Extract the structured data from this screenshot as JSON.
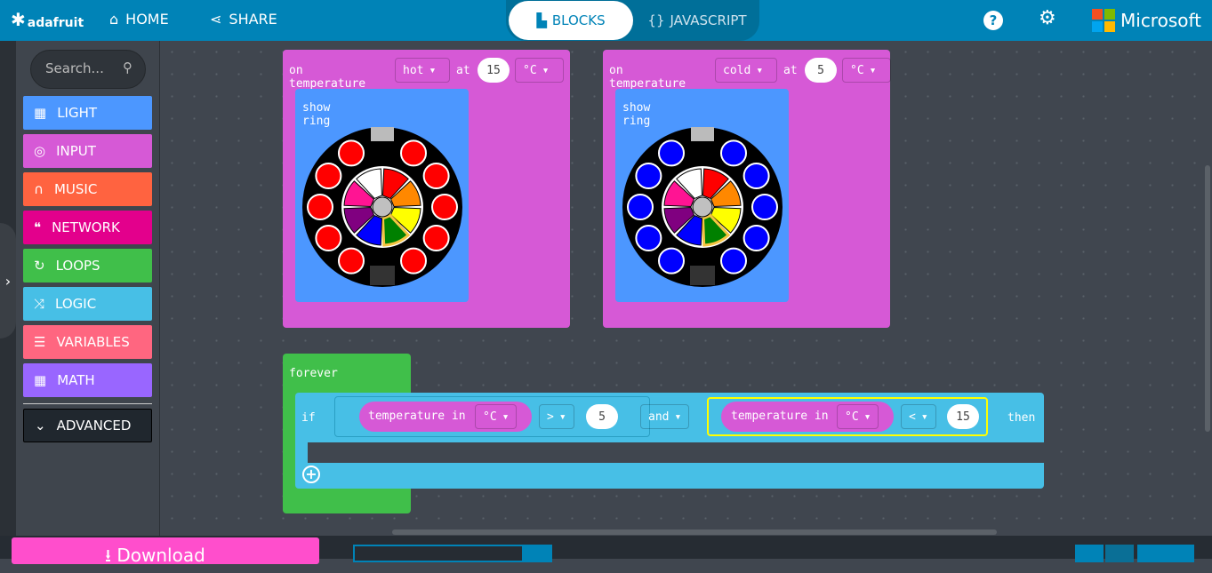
{
  "header": {
    "brand": "adafruit",
    "home": "HOME",
    "share": "SHARE",
    "tabs": {
      "blocks": "BLOCKS",
      "javascript": "JAVASCRIPT",
      "active": "blocks"
    },
    "microsoft": "Microsoft"
  },
  "toolbox": {
    "search_placeholder": "Search...",
    "categories": [
      {
        "label": "LIGHT",
        "color": "#4c97ff",
        "icon": "grid-icon"
      },
      {
        "label": "INPUT",
        "color": "#d659d6",
        "icon": "target-icon"
      },
      {
        "label": "MUSIC",
        "color": "#ff6340",
        "icon": "headphones-icon"
      },
      {
        "label": "NETWORK",
        "color": "#e3008c",
        "icon": "chat-icon"
      },
      {
        "label": "LOOPS",
        "color": "#40bf4a",
        "icon": "loop-icon"
      },
      {
        "label": "LOGIC",
        "color": "#47bfe6",
        "icon": "shuffle-icon"
      },
      {
        "label": "VARIABLES",
        "color": "#ff6680",
        "icon": "lines-icon"
      },
      {
        "label": "MATH",
        "color": "#9966ff",
        "icon": "calculator-icon"
      }
    ],
    "advanced": "ADVANCED"
  },
  "blocks": {
    "hot": {
      "prefix": "on temperature",
      "condition": "hot",
      "at": "at",
      "value": "15",
      "unit": "°C",
      "show_ring": "show ring",
      "led_color": "#ff0000"
    },
    "cold": {
      "prefix": "on temperature",
      "condition": "cold",
      "at": "at",
      "value": "5",
      "unit": "°C",
      "show_ring": "show ring",
      "led_color": "#0000ff"
    },
    "forever": {
      "label": "forever",
      "if": "if",
      "then": "then",
      "left": {
        "reporter": "temperature in",
        "unit": "°C",
        "op": ">",
        "value": "5"
      },
      "joiner": "and",
      "right": {
        "reporter": "temperature in",
        "unit": "°C",
        "op": "<",
        "value": "15"
      }
    }
  },
  "wheel_colors": [
    "#ffffff",
    "#ff0000",
    "#ff8800",
    "#ffff00",
    "#008000",
    "#0000ff",
    "#800080",
    "#ff1493"
  ],
  "footer": {
    "download": "Download"
  }
}
